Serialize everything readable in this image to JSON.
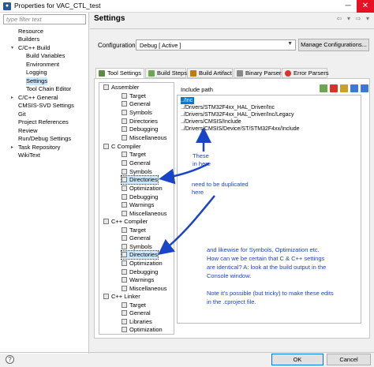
{
  "window": {
    "title": "Properties for VAC_CTL_test"
  },
  "filter": {
    "placeholder": "type filter text"
  },
  "nav": [
    {
      "label": "Resource"
    },
    {
      "label": "Builders"
    },
    {
      "label": "C/C++ Build"
    },
    {
      "label": "Build Variables"
    },
    {
      "label": "Environment"
    },
    {
      "label": "Logging"
    },
    {
      "label": "Settings"
    },
    {
      "label": "Tool Chain Editor"
    },
    {
      "label": "C/C++ General"
    },
    {
      "label": "CMSIS-SVD Settings"
    },
    {
      "label": "Git"
    },
    {
      "label": "Project References"
    },
    {
      "label": "Review"
    },
    {
      "label": "Run/Debug Settings"
    },
    {
      "label": "Task Repository"
    },
    {
      "label": "WikiText"
    }
  ],
  "settings": {
    "title": "Settings",
    "config_label": "Configuration:",
    "config_value": "Debug  [ Active ]",
    "manage_button": "Manage Configurations..."
  },
  "tabs": [
    {
      "label": "Tool Settings"
    },
    {
      "label": "Build Steps"
    },
    {
      "label": "Build Artifact"
    },
    {
      "label": "Binary Parsers"
    },
    {
      "label": "Error Parsers"
    }
  ],
  "tree": [
    {
      "label": "Assembler"
    },
    {
      "label": "Target"
    },
    {
      "label": "General"
    },
    {
      "label": "Symbols"
    },
    {
      "label": "Directories"
    },
    {
      "label": "Debugging"
    },
    {
      "label": "Miscellaneous"
    },
    {
      "label": "C Compiler"
    },
    {
      "label": "Target"
    },
    {
      "label": "General"
    },
    {
      "label": "Symbols"
    },
    {
      "label": "Directories"
    },
    {
      "label": "Optimization"
    },
    {
      "label": "Debugging"
    },
    {
      "label": "Warnings"
    },
    {
      "label": "Miscellaneous"
    },
    {
      "label": "C++ Compiler"
    },
    {
      "label": "Target"
    },
    {
      "label": "General"
    },
    {
      "label": "Symbols"
    },
    {
      "label": "Directories"
    },
    {
      "label": "Optimization"
    },
    {
      "label": "Debugging"
    },
    {
      "label": "Warnings"
    },
    {
      "label": "Miscellaneous"
    },
    {
      "label": "C++ Linker"
    },
    {
      "label": "Target"
    },
    {
      "label": "General"
    },
    {
      "label": "Libraries"
    },
    {
      "label": "Optimization"
    }
  ],
  "include": {
    "label": "Include path",
    "paths": [
      "../Inc",
      "../Drivers/STM32F4xx_HAL_Driver/Inc",
      "../Drivers/STM32F4xx_HAL_Driver/Inc/Legacy",
      "../Drivers/CMSIS/Include",
      "../Drivers/CMSIS/Device/ST/STM32F4xx/Include"
    ]
  },
  "annotations": {
    "these_line1": "These",
    "these_line2": "in here",
    "dup_line1": "need to be duplicated",
    "dup_line2": "here",
    "note_lines": [
      "and likewise for Symbols, Optimization etc.",
      "How can we be certain that C & C++ settings",
      "are identical? A: look at the build output in the",
      "Console window.",
      "",
      "Note it's possible (but tricky) to make these edits",
      "in the .cproject file."
    ]
  },
  "buttons": {
    "ok": "OK",
    "cancel": "Cancel"
  },
  "colors": {
    "annotation": "#1a44c8",
    "selection": "#0078d7"
  }
}
